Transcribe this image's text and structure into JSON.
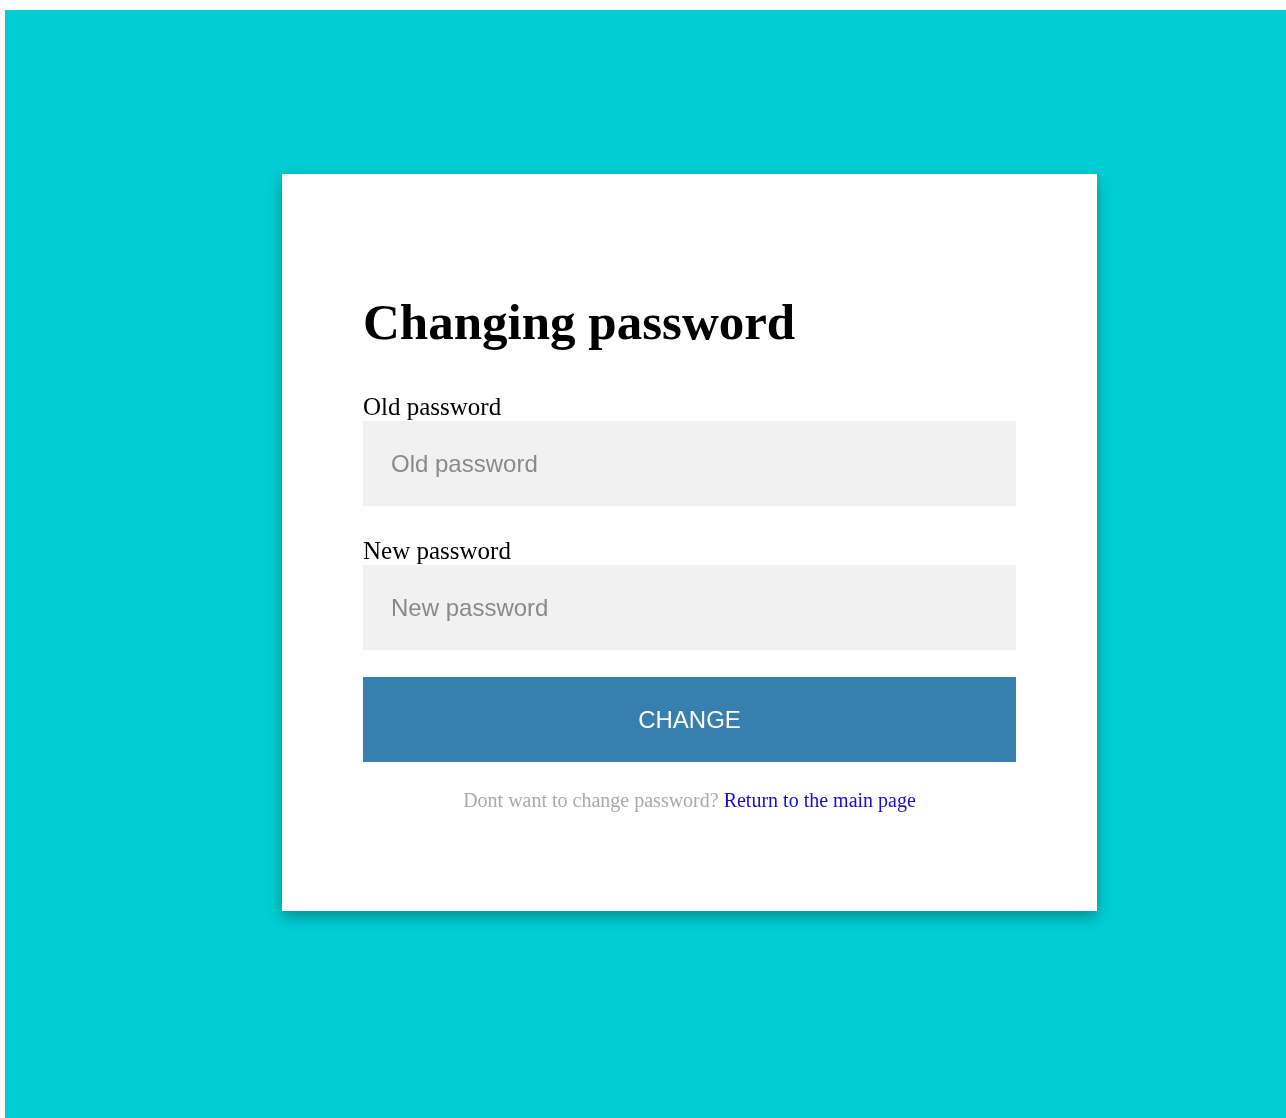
{
  "title": "Changing password",
  "fields": [
    {
      "label": "Old password",
      "placeholder": "Old password"
    },
    {
      "label": "New password",
      "placeholder": "New password"
    }
  ],
  "button": "CHANGE",
  "footer": {
    "text": "Dont want to change password?",
    "link": "Return to the main page"
  }
}
